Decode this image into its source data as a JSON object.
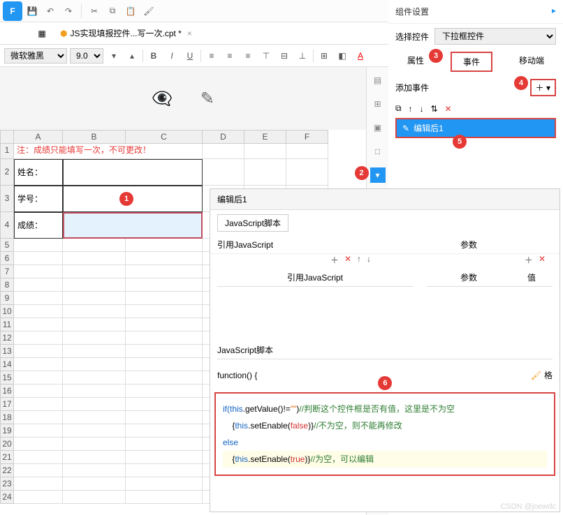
{
  "tab": {
    "filename": "JS实现填报控件...写一次.cpt *"
  },
  "format": {
    "font": "微软雅黑",
    "size": "9.0"
  },
  "sheet": {
    "columns": [
      "A",
      "B",
      "C",
      "D",
      "E",
      "F"
    ],
    "note": "注：成绩只能填写一次，不可更改！",
    "rows": [
      {
        "label": "姓名："
      },
      {
        "label": "学号："
      },
      {
        "label": "成绩："
      }
    ]
  },
  "component": {
    "title": "组件设置",
    "select_label": "选择控件",
    "select_value": "下拉框控件",
    "tabs": [
      "属性",
      "事件",
      "移动端"
    ],
    "add_event": "添加事件",
    "event_item": "编辑后1"
  },
  "script": {
    "header": "编辑后1",
    "tab": "JavaScript脚本",
    "col_import": "引用JavaScript",
    "col_params": "参数",
    "h_import": "引用JavaScript",
    "h_param": "参数",
    "h_value": "值",
    "section_label": "JavaScript脚本",
    "func_label": "function() {",
    "brush": "格",
    "code": {
      "l1_a": "if(",
      "l1_b": "this",
      "l1_c": ".getValue()!=",
      "l1_d": "\"\"",
      "l1_e": ")",
      "l1_cmt": "//判断这个控件框是否有值，这里是不为空",
      "l2_a": "    {",
      "l2_b": "this",
      "l2_c": ".setEnable(",
      "l2_d": "false",
      "l2_e": ")}",
      "l2_cmt": "//不为空，则不能再修改",
      "l3": "else",
      "l4_a": "    {",
      "l4_b": "this",
      "l4_c": ".setEnable(",
      "l4_d": "true",
      "l4_e": ")}",
      "l4_cmt": "//为空，可以编辑"
    }
  },
  "watermark": "CSDN @joewdc"
}
